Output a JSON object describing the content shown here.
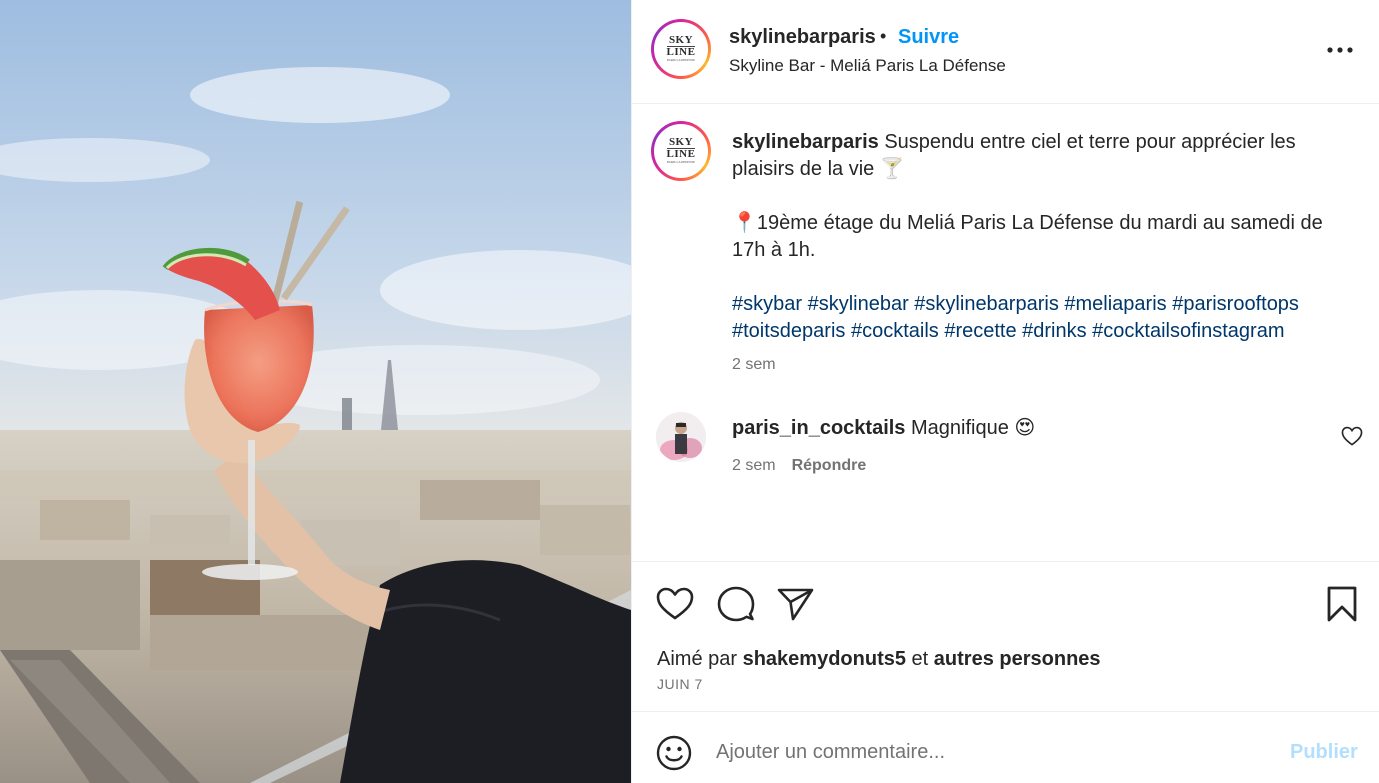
{
  "post": {
    "username": "skylinebarparis",
    "separator": "•",
    "follow_label": "Suivre",
    "location": "Skyline Bar - Meliá Paris La Défense",
    "more_label": "•••",
    "avatar_text": {
      "line1": "SKY",
      "line2": "LINE",
      "line3": "PARIS LA DEFENSE"
    }
  },
  "caption": {
    "username": "skylinebarparis",
    "line1": "Suspendu entre ciel et terre pour apprécier les plaisirs de la vie 🍸",
    "line2": "📍19ème étage du Meliá Paris La Défense du mardi au samedi de 17h à 1h.",
    "hashtags": "#skybar #skylinebar #skylinebarparis #meliaparis #parisrooftops #toitsdeparis #cocktails #recette #drinks #cocktailsofinstagram",
    "time": "2 sem"
  },
  "comment": {
    "username": "paris_in_cocktails",
    "text": "Magnifique 😍",
    "time": "2 sem",
    "reply_label": "Répondre"
  },
  "likes": {
    "prefix": "Aimé par",
    "user": "shakemydonuts5",
    "middle": "et",
    "others": "autres personnes"
  },
  "date": "JUIN 7",
  "add_comment": {
    "placeholder": "Ajouter un commentaire...",
    "publish_label": "Publier"
  },
  "icons": [
    "heart-icon",
    "comment-icon",
    "share-icon",
    "bookmark-icon",
    "emoji-icon",
    "more-icon"
  ],
  "colors": {
    "link": "#0095f6",
    "hashtag": "#00376b",
    "muted": "#737373",
    "publish_disabled": "#b2dffc"
  }
}
